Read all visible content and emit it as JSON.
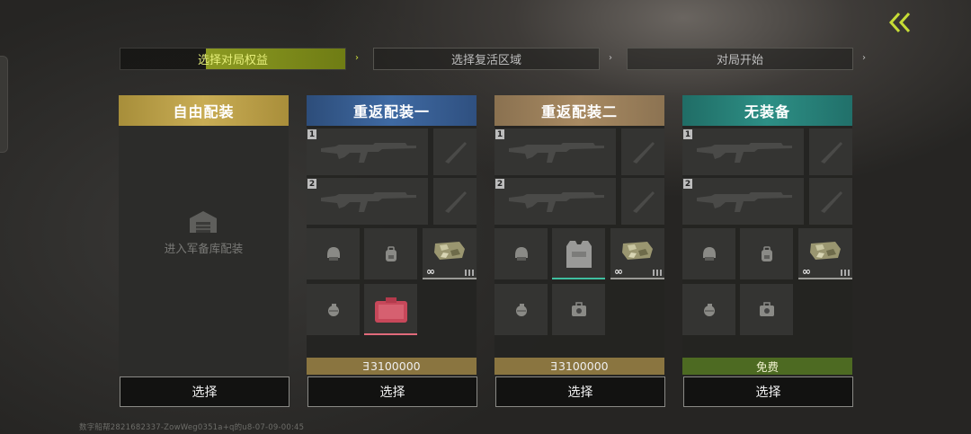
{
  "steps": [
    {
      "label": "选择对局权益",
      "active": true
    },
    {
      "label": "选择复活区域",
      "active": false
    },
    {
      "label": "对局开始",
      "active": false
    }
  ],
  "arrows": [
    "›",
    "›",
    "›"
  ],
  "cards": [
    {
      "title": "自由配装",
      "warehouse_label": "进入军备库配装",
      "select_label": "选择",
      "header_color": "#c0a54e"
    },
    {
      "title": "重返配装一",
      "price": "3100000",
      "price_icon": "coin-icon",
      "select_label": "选择",
      "header_color": "#3a6296"
    },
    {
      "title": "重返配装二",
      "price": "3100000",
      "price_icon": "coin-icon",
      "select_label": "选择",
      "header_color": "#a0845d"
    },
    {
      "title": "无装备",
      "price": "免费",
      "select_label": "选择",
      "header_color": "#2a877e"
    }
  ],
  "slot_numbers": [
    "1",
    "2"
  ],
  "infinity_symbol": "∞",
  "colors": {
    "accent": "#cfe03a",
    "vest_line": "#3fbfa0",
    "medkit_line": "#e06a7a"
  },
  "footer": "数字船帮2821682337-ZowWeg0351a+q的u8-07-09-00:45"
}
